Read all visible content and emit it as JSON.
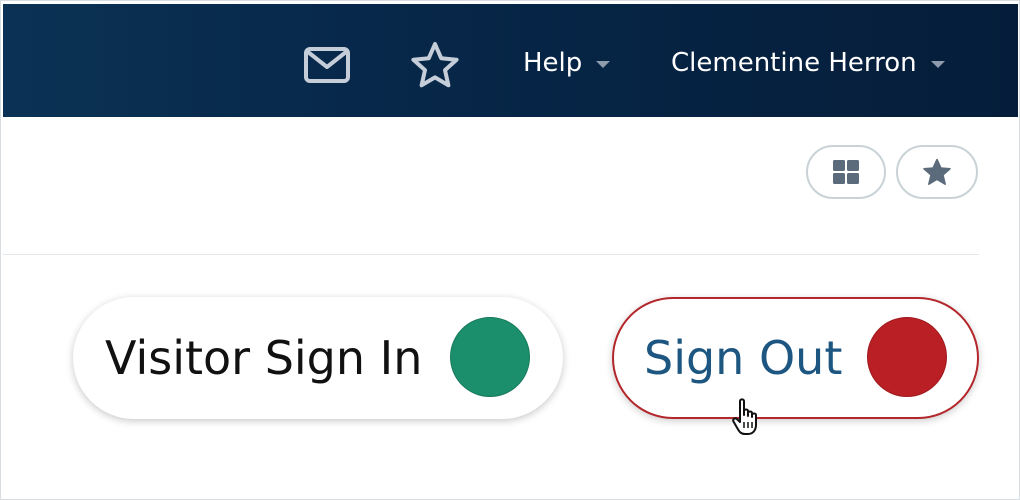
{
  "header": {
    "mail_icon": "mail-icon",
    "favorites_icon": "star-outline-icon",
    "help_label": "Help",
    "user_name": "Clementine Herron"
  },
  "toolbar": {
    "grid_icon": "grid-icon",
    "star_icon": "star-filled-icon"
  },
  "actions": {
    "visitor_sign_in_label": "Visitor Sign In",
    "sign_out_label": "Sign Out"
  },
  "colors": {
    "header_bg": "#06264a",
    "sign_in_green": "#1b8f6c",
    "sign_out_red": "#b91f24",
    "sign_out_text": "#1d5680",
    "sign_out_border": "#b3262b",
    "toolbar_icon": "#5b6b7c"
  }
}
